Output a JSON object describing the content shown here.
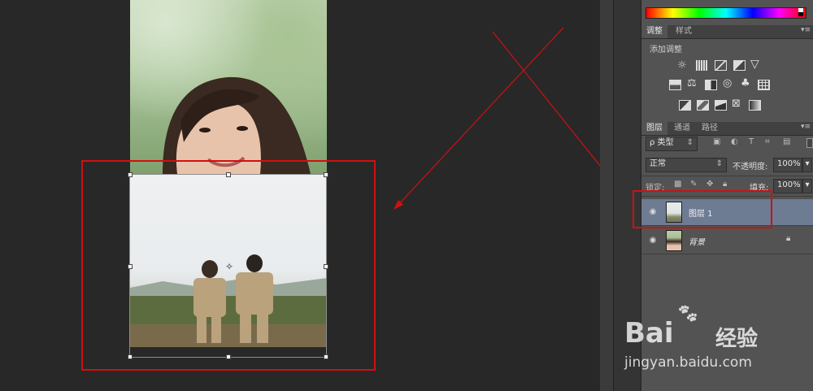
{
  "colors": {
    "accent_red": "#d01010",
    "panel_bg": "#535353",
    "selected_layer": "#6d7b93"
  },
  "adjustments_panel": {
    "tabs": [
      "调整",
      "样式"
    ],
    "add_adjustment": "添加调整"
  },
  "layers_panel": {
    "tabs": [
      "图层",
      "通道",
      "路径"
    ],
    "filter_kind": "ρ 类型",
    "blend_mode": "正常",
    "opacity_label": "不透明度:",
    "opacity_value": "100%",
    "lock_label": "锁定:",
    "fill_label": "填充:",
    "fill_value": "100%",
    "layers": [
      {
        "name": "图层 1",
        "selected": true,
        "locked": false
      },
      {
        "name": "背景",
        "selected": false,
        "locked": true
      }
    ]
  },
  "watermark": {
    "logo": "Bai",
    "logo2": "经验",
    "url": "jingyan.baidu.com"
  }
}
